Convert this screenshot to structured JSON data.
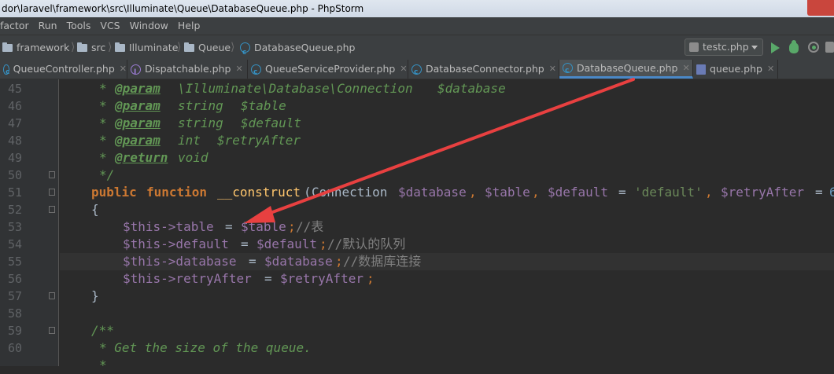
{
  "window": {
    "title": "dor\\laravel\\framework\\src\\Illuminate\\Queue\\DatabaseQueue.php - PhpStorm"
  },
  "menu": {
    "items": [
      {
        "label": "factor"
      },
      {
        "label": "Run"
      },
      {
        "label": "Tools"
      },
      {
        "label": "VCS"
      },
      {
        "label": "Window"
      },
      {
        "label": "Help"
      }
    ]
  },
  "breadcrumbs": [
    {
      "label": "framework"
    },
    {
      "label": "src"
    },
    {
      "label": "Illuminate"
    },
    {
      "label": "Queue"
    },
    {
      "label": "DatabaseQueue.php"
    }
  ],
  "run_config": {
    "label": "testc.php"
  },
  "tabs": [
    {
      "label": "QueueController.php",
      "icon": "class-icon",
      "active": false
    },
    {
      "label": "Dispatchable.php",
      "icon": "trait-icon",
      "active": false
    },
    {
      "label": "QueueServiceProvider.php",
      "icon": "class-icon",
      "active": false
    },
    {
      "label": "DatabaseConnector.php",
      "icon": "class-icon",
      "active": false
    },
    {
      "label": "DatabaseQueue.php",
      "icon": "class-icon",
      "active": true
    },
    {
      "label": "queue.php",
      "icon": "php-file-icon",
      "active": false
    }
  ],
  "editor": {
    "line_numbers": [
      "45",
      "46",
      "47",
      "48",
      "49",
      "50",
      "51",
      "52",
      "53",
      "54",
      "55",
      "56",
      "57",
      "58",
      "59",
      "60",
      ""
    ],
    "lines": [
      {
        "n": "45",
        "text": "     * @param  \\Illuminate\\Database\\Connection  $database"
      },
      {
        "n": "46",
        "text": "     * @param  string  $table"
      },
      {
        "n": "47",
        "text": "     * @param  string  $default"
      },
      {
        "n": "48",
        "text": "     * @param  int  $retryAfter"
      },
      {
        "n": "49",
        "text": "     * @return void"
      },
      {
        "n": "50",
        "text": "     */"
      },
      {
        "n": "51",
        "text": "    public function __construct(Connection $database, $table, $default = 'default', $retryAfter = 6"
      },
      {
        "n": "52",
        "text": "    {"
      },
      {
        "n": "53",
        "text": "        $this->table = $table;//表"
      },
      {
        "n": "54",
        "text": "        $this->default = $default;//默认的队列"
      },
      {
        "n": "55",
        "text": "        $this->database = $database;//数据库连接"
      },
      {
        "n": "56",
        "text": "        $this->retryAfter = $retryAfter;"
      },
      {
        "n": "57",
        "text": "    }"
      },
      {
        "n": "58",
        "text": ""
      },
      {
        "n": "59",
        "text": "    /**"
      },
      {
        "n": "60",
        "text": "     * Get the size of the queue."
      },
      {
        "n": "",
        "text": "     *"
      }
    ],
    "current_line": "55"
  },
  "tokens": {
    "star": "*",
    "param": "@param",
    "return": "@return",
    "connection_type": "\\Illuminate\\Database\\Connection",
    "string": "string",
    "int": "int",
    "void": "void",
    "var_database": "$database",
    "var_table": "$table",
    "var_default": "$default",
    "var_retryAfter": "$retryAfter",
    "close_doc": "*/",
    "public": "public",
    "function": "function",
    "construct": "__construct",
    "lparen": "(",
    "Connection": "Connection",
    "comma": ",",
    "eq": "=",
    "str_default": "'default'",
    "num6": "6",
    "lbrace": "{",
    "rbrace": "}",
    "this_table": "$this->table",
    "this_default": "$this->default",
    "this_database": "$this->database",
    "this_retryAfter": "$this->retryAfter",
    "semi": ";",
    "c_table": "//表",
    "c_default": "//默认的队列",
    "c_database": "//数据库连接",
    "open_doc": "/**",
    "get_size": "* Get the size of the queue."
  },
  "colors": {
    "editor_bg": "#2b2b2b",
    "doc_comment": "#629755",
    "keyword": "#cc7832",
    "function": "#ffc66d",
    "variable": "#9876aa",
    "string": "#6a8759",
    "annotation_arrow": "#e84040"
  }
}
